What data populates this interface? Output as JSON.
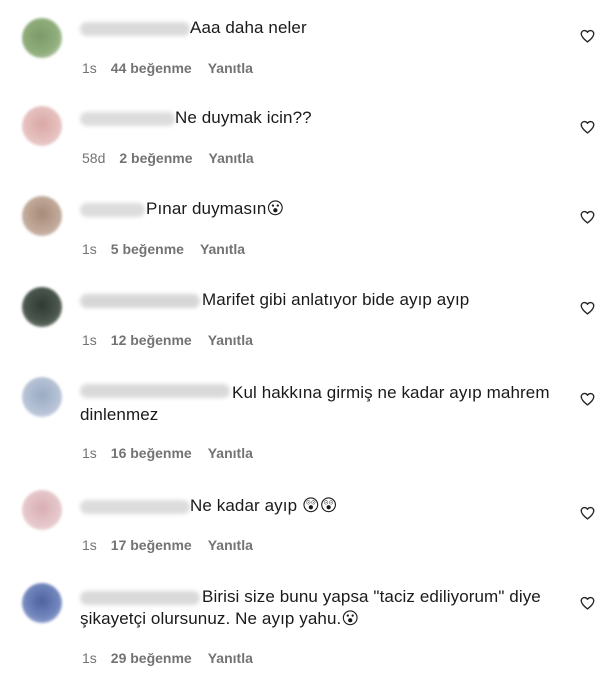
{
  "comments": [
    {
      "text": "Aaa daha neler",
      "time": "1s",
      "likes": "44 beğenme",
      "reply": "Yanıtla",
      "avatar_color": "#7d9a6a"
    },
    {
      "text": "Ne duymak icin??",
      "time": "58d",
      "likes": "2 beğenme",
      "reply": "Yanıtla",
      "avatar_color": "#d9a7a4"
    },
    {
      "text": "Pınar duymasın😮",
      "time": "1s",
      "likes": "5 beğenme",
      "reply": "Yanıtla",
      "avatar_color": "#b59a89"
    },
    {
      "text": "Marifet gibi anlatıyor bide ayıp ayıp",
      "time": "1s",
      "likes": "12 beğenme",
      "reply": "Yanıtla",
      "avatar_color": "#3f4a42"
    },
    {
      "text": "Kul hakkına girmiş ne kadar ayıp mahrem dinlenmez",
      "time": "1s",
      "likes": "16 beğenme",
      "reply": "Yanıtla",
      "avatar_color": "#a9b6c8"
    },
    {
      "text": "Ne kadar ayıp 😲😲",
      "time": "1s",
      "likes": "17 beğenme",
      "reply": "Yanıtla",
      "avatar_color": "#d8b2b6"
    },
    {
      "text": "Birisi size bunu yapsa \"taciz ediliyorum\" diye şikayetçi olursunuz. Ne ayıp yahu.😮",
      "time": "1s",
      "likes": "29 beğenme",
      "reply": "Yanıtla",
      "avatar_color": "#5a6fa6"
    }
  ],
  "heart_icon": "heart-outline-icon",
  "colors": {
    "text": "#1a1a1a",
    "meta": "#737373",
    "username_blur": "#c8c8c8"
  }
}
